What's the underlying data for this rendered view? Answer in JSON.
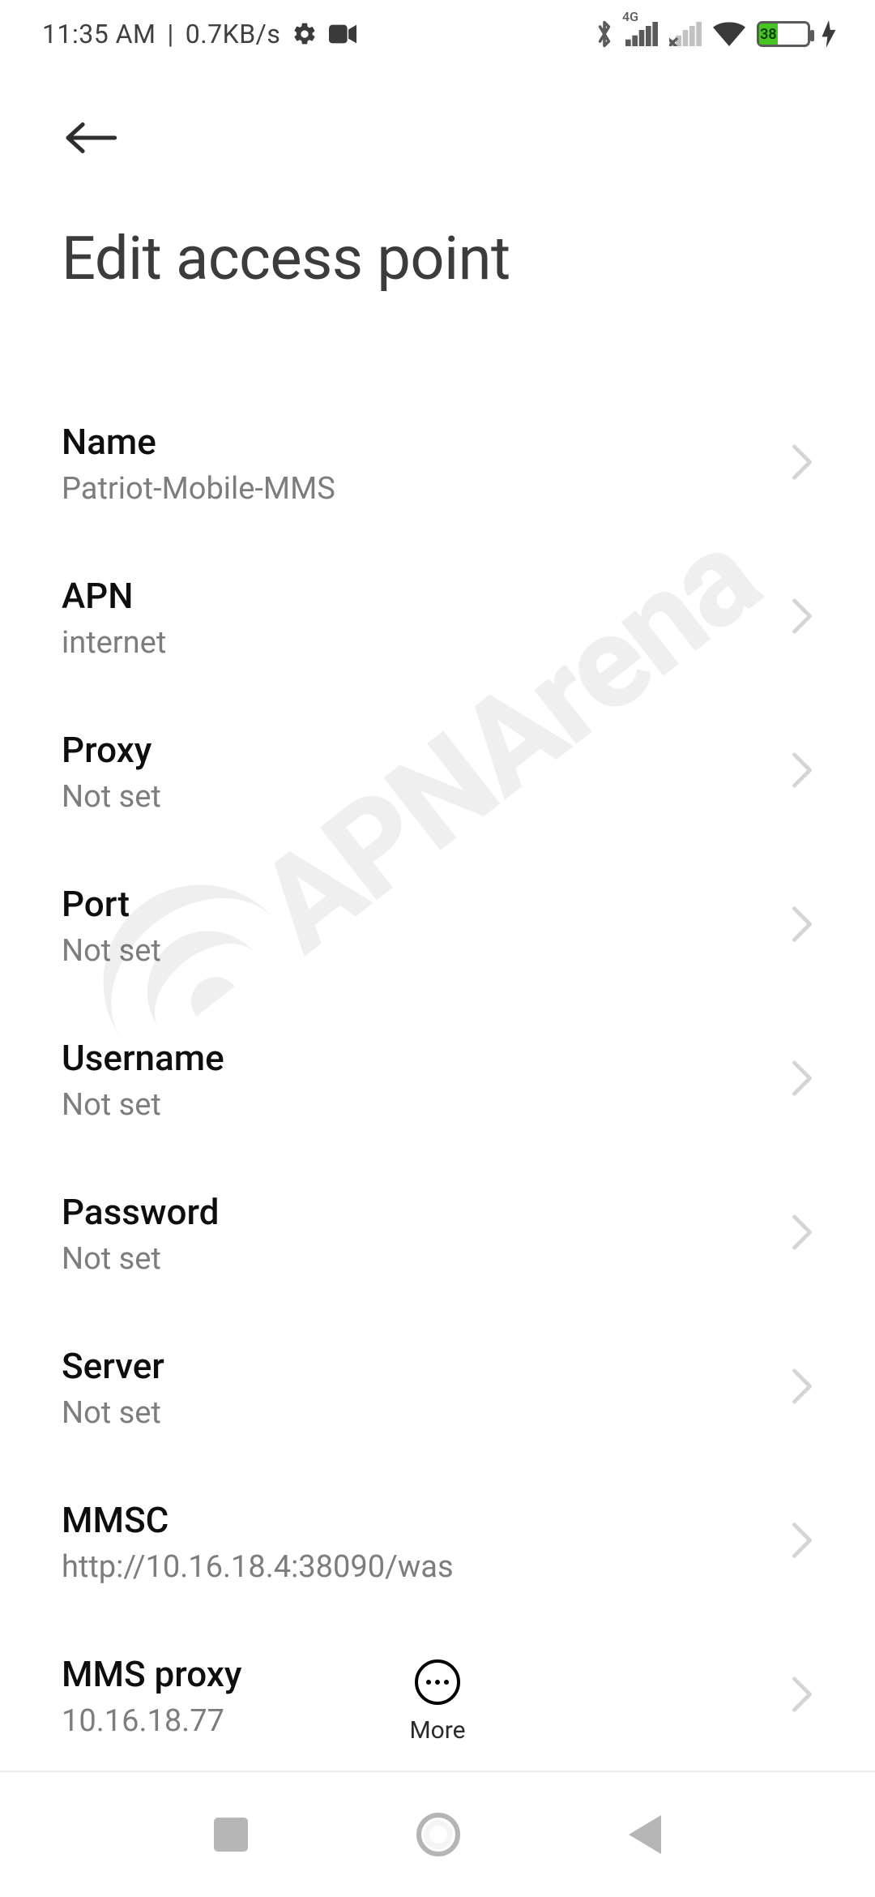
{
  "status": {
    "time": "11:35 AM",
    "separator": "|",
    "net_speed": "0.7KB/s",
    "signal_label": "4G",
    "battery_percent": "38"
  },
  "page": {
    "title": "Edit access point"
  },
  "settings": [
    {
      "key": "name",
      "label": "Name",
      "value": "Patriot-Mobile-MMS"
    },
    {
      "key": "apn",
      "label": "APN",
      "value": "internet"
    },
    {
      "key": "proxy",
      "label": "Proxy",
      "value": "Not set"
    },
    {
      "key": "port",
      "label": "Port",
      "value": "Not set"
    },
    {
      "key": "username",
      "label": "Username",
      "value": "Not set"
    },
    {
      "key": "password",
      "label": "Password",
      "value": "Not set"
    },
    {
      "key": "server",
      "label": "Server",
      "value": "Not set"
    },
    {
      "key": "mmsc",
      "label": "MMSC",
      "value": "http://10.16.18.4:38090/was"
    },
    {
      "key": "mms_proxy",
      "label": "MMS proxy",
      "value": "10.16.18.77"
    }
  ],
  "actions": {
    "more_label": "More"
  },
  "watermark": "APNArena"
}
